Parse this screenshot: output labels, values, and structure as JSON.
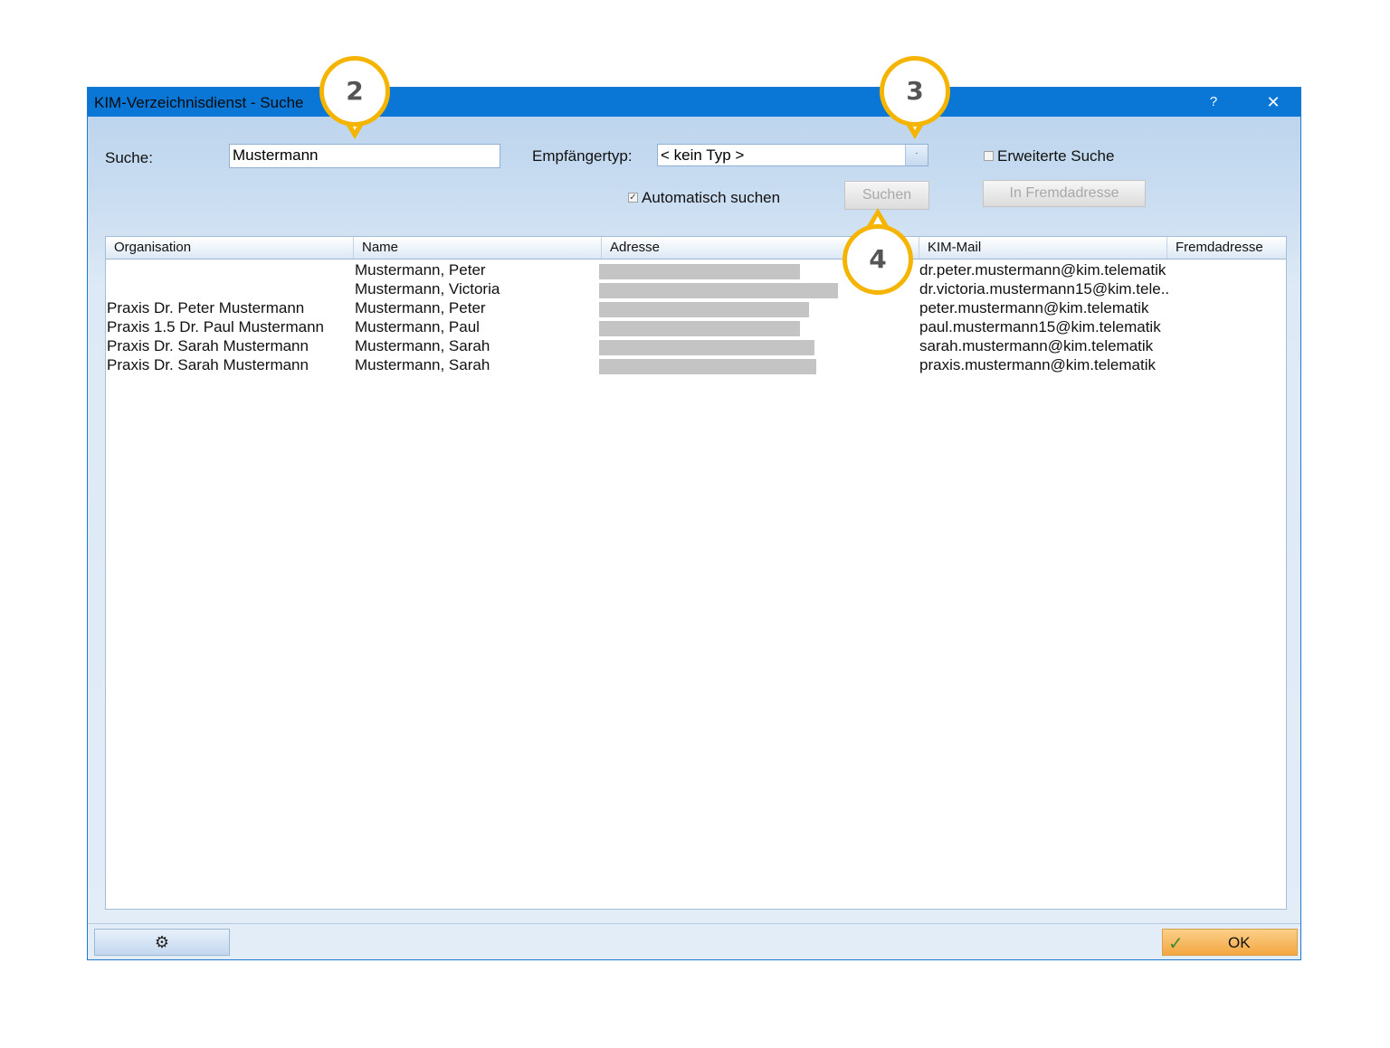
{
  "window": {
    "title": "KIM-Verzeichnisdienst - Suche",
    "help_label": "?",
    "close_label": "✕"
  },
  "search": {
    "label": "Suche:",
    "value": "Mustermann"
  },
  "recipient_type": {
    "label": "Empfängertyp:",
    "value": "< kein Typ >",
    "dropdown_glyph": "·"
  },
  "extended_search": {
    "label": "Erweiterte Suche",
    "checked": false
  },
  "auto_search": {
    "label": "Automatisch suchen",
    "checked": true,
    "check_glyph": "✓"
  },
  "buttons": {
    "search": "Suchen",
    "foreign_address": "In Fremdadresse",
    "ok": "OK",
    "ok_icon": "✓",
    "settings_icon": "⚙"
  },
  "table": {
    "columns": [
      "Organisation",
      "Name",
      "Adresse",
      "KIM-Mail",
      "Fremdadresse"
    ],
    "rows": [
      {
        "organisation": "",
        "name": "Mustermann, Peter",
        "mail": "dr.peter.mustermann@kim.telematik"
      },
      {
        "organisation": "",
        "name": "Mustermann, Victoria",
        "mail": "dr.victoria.mustermann15@kim.tele.."
      },
      {
        "organisation": "Praxis Dr. Peter Mustermann",
        "name": "Mustermann, Peter",
        "mail": "peter.mustermann@kim.telematik"
      },
      {
        "organisation": "Praxis 1.5 Dr. Paul Mustermann",
        "name": "Mustermann, Paul",
        "mail": "paul.mustermann15@kim.telematik"
      },
      {
        "organisation": "Praxis Dr. Sarah Mustermann",
        "name": "Mustermann, Sarah",
        "mail": "sarah.mustermann@kim.telematik"
      },
      {
        "organisation": "Praxis Dr. Sarah Mustermann",
        "name": "Mustermann, Sarah",
        "mail": "praxis.mustermann@kim.telematik"
      }
    ]
  },
  "callouts": [
    "2",
    "3",
    "4"
  ],
  "colors": {
    "titlebar": "#0a76d6",
    "callout_ring": "#f5b400",
    "ok_button": "#f4a640"
  }
}
